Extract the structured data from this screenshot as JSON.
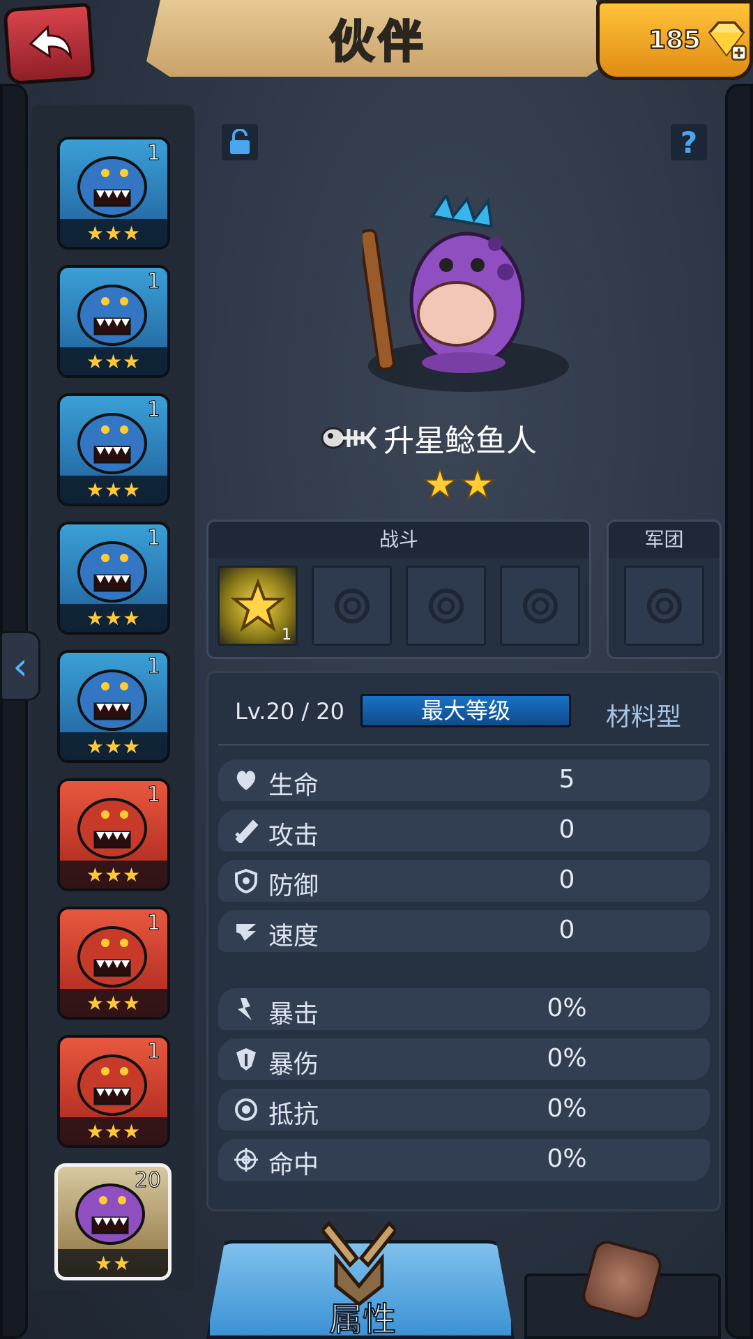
{
  "header": {
    "title": "伙伴",
    "back_icon": "back-arrow-icon",
    "gems": "185",
    "gem_icon": "diamond-plus-icon"
  },
  "companion_list": [
    {
      "level": "1",
      "stars": "★★★",
      "theme": "blue"
    },
    {
      "level": "1",
      "stars": "★★★",
      "theme": "blue"
    },
    {
      "level": "1",
      "stars": "★★★",
      "theme": "blue"
    },
    {
      "level": "1",
      "stars": "★★★",
      "theme": "blue"
    },
    {
      "level": "1",
      "stars": "★★★",
      "theme": "blue"
    },
    {
      "level": "1",
      "stars": "★★★",
      "theme": "red"
    },
    {
      "level": "1",
      "stars": "★★★",
      "theme": "red"
    },
    {
      "level": "1",
      "stars": "★★★",
      "theme": "red"
    },
    {
      "level": "20",
      "stars": "★★",
      "theme": "selected"
    }
  ],
  "hero": {
    "name": "升星鲶鱼人",
    "stars": "★★",
    "name_icon": "fish-skeleton-icon"
  },
  "battle": {
    "label": "战斗",
    "first_slot_count": "1"
  },
  "legion": {
    "label": "军团"
  },
  "stats": {
    "level": "Lv.20 / 20",
    "max_level": "最大等级",
    "type": "材料型",
    "rows": [
      {
        "label": "生命",
        "value": "5",
        "icon": "heart-icon"
      },
      {
        "label": "攻击",
        "value": "0",
        "icon": "sword-icon"
      },
      {
        "label": "防御",
        "value": "0",
        "icon": "shield-icon"
      },
      {
        "label": "速度",
        "value": "0",
        "icon": "wing-icon"
      },
      {
        "label": "暴击",
        "value": "0%",
        "icon": "crit-icon"
      },
      {
        "label": "暴伤",
        "value": "0%",
        "icon": "crit-damage-icon"
      },
      {
        "label": "抵抗",
        "value": "0%",
        "icon": "resist-icon"
      },
      {
        "label": "命中",
        "value": "0%",
        "icon": "target-icon"
      }
    ]
  },
  "tabs": {
    "attributes": "属性"
  },
  "colors": {
    "accent_blue": "#3c92d4",
    "gold": "#ffc93a",
    "panel": "#263142"
  }
}
